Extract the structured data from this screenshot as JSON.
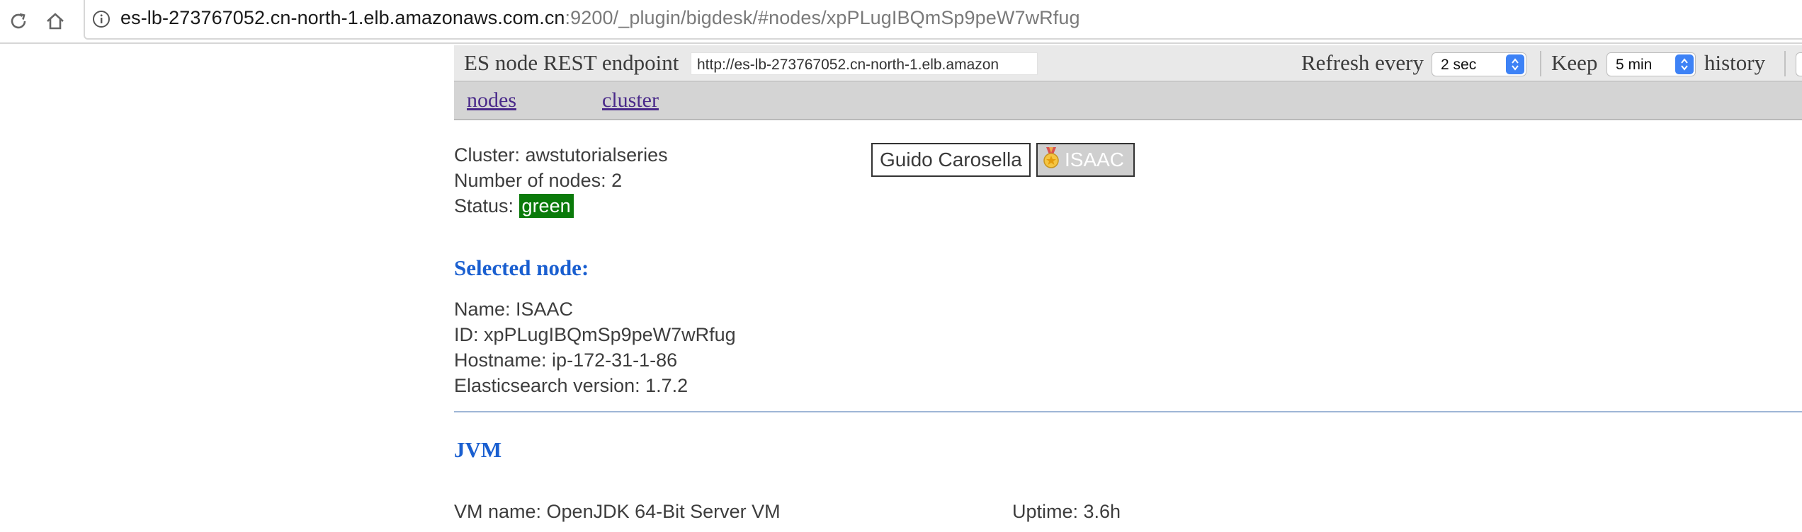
{
  "browser": {
    "url_host": "es-lb-273767052.cn-north-1.elb.amazonaws.com.cn",
    "url_rest": ":9200/_plugin/bigdesk/#nodes/xpPLugIBQmSp9peW7wRfug"
  },
  "toolbar": {
    "endpoint_label": "ES node REST endpoint",
    "endpoint_value": "http://es-lb-273767052.cn-north-1.elb.amazon",
    "refresh_label": "Refresh every",
    "refresh_value": "2 sec",
    "keep_label": "Keep",
    "keep_value": "5 min",
    "history_label": "history"
  },
  "tabs": {
    "nodes": "nodes",
    "cluster": "cluster"
  },
  "cluster": {
    "name_line": "Cluster: awstutorialseries",
    "nodes_line": "Number of nodes: 2",
    "status_label": "Status: ",
    "status_value": "green",
    "status_color": "#0a7a0a"
  },
  "node_buttons": [
    {
      "label": "Guido Carosella"
    },
    {
      "label": "ISAAC",
      "icon": "master-node-medal-icon"
    }
  ],
  "selected_node": {
    "title": "Selected node:",
    "name_line": "Name: ISAAC",
    "id_line": "ID: xpPLugIBQmSp9peW7wRfug",
    "hostname_line": "Hostname: ip-172-31-1-86",
    "version_line": "Elasticsearch version: 1.7.2"
  },
  "jvm": {
    "title": "JVM",
    "vm_name_line": "VM name: OpenJDK 64-Bit Server VM",
    "uptime_line": "Uptime: 3.6h"
  },
  "colors": {
    "link": "#4a2a8a",
    "section_title": "#1a5fd0",
    "select_arrow": "#3d82f6"
  }
}
